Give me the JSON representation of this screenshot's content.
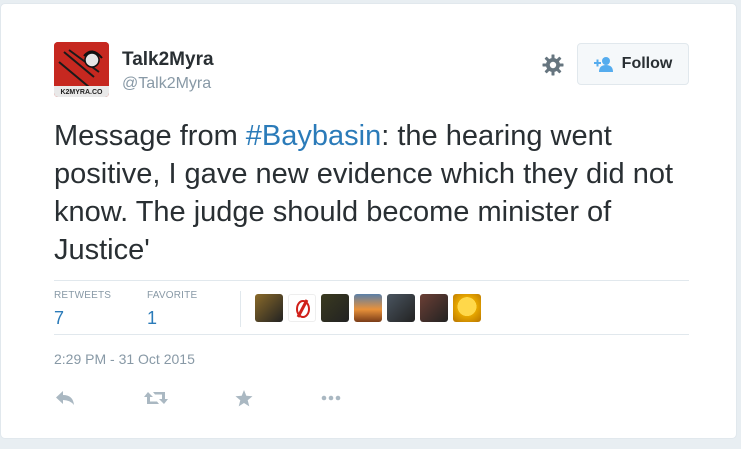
{
  "author": {
    "name": "Talk2Myra",
    "handle": "@Talk2Myra",
    "avatar_text": "K2MYRA.CO"
  },
  "follow_button": {
    "label": "Follow"
  },
  "tweet": {
    "text_before": "Message from ",
    "hashtag": "#Baybasin",
    "text_after": ": the hearing went positive, I gave new evidence which they did not know. The judge should become minister of Justice'"
  },
  "stats": {
    "retweets_label": "RETWEETS",
    "retweets_count": "7",
    "favorites_label": "FAVORITE",
    "favorites_count": "1"
  },
  "favoriters": [
    {
      "icon": "lion-avatar",
      "color": "#8a6a2a"
    },
    {
      "icon": "red-logo-avatar",
      "color": "#ffffff"
    },
    {
      "icon": "yellow-black-avatar",
      "color": "#3a3a20"
    },
    {
      "icon": "sunset-avatar",
      "color": "#d9762c"
    },
    {
      "icon": "man-portrait-avatar",
      "color": "#4a5560"
    },
    {
      "icon": "group-photo-avatar",
      "color": "#6b3f35"
    },
    {
      "icon": "sun-avatar",
      "color": "#e8a800"
    }
  ],
  "timestamp": "2:29 PM - 31 Oct 2015",
  "colors": {
    "link": "#2b7bb9",
    "muted": "#8899a6",
    "text": "#292f33",
    "border": "#e1e8ed"
  }
}
